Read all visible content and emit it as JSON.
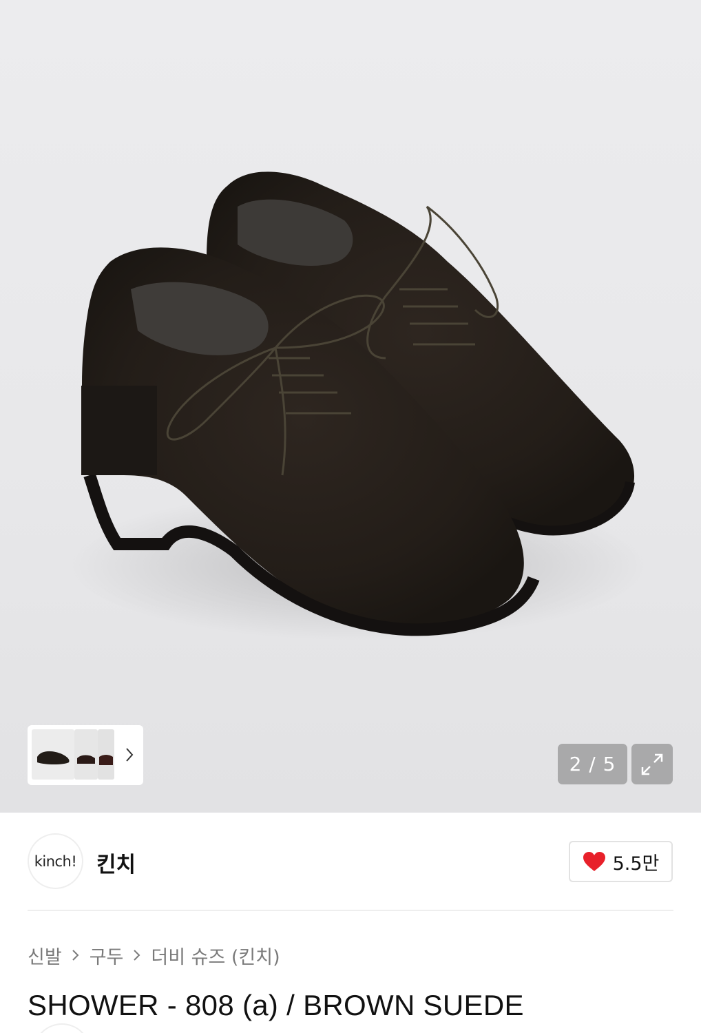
{
  "gallery": {
    "current": 2,
    "total": 5,
    "counter_text": "2 / 5",
    "thumbnails": [
      "shoe-pair-thumb",
      "shoe-side-thumb",
      "shoe-detail-thumb"
    ],
    "next_icon": "chevron-right-icon",
    "fullscreen_icon": "expand-arrows-icon",
    "background_color": "#e9e9eb"
  },
  "brand": {
    "logo_text": "kinch!",
    "name": "킨치",
    "likes": "5.5만",
    "like_icon": "heart-icon",
    "like_color": "#e8202a"
  },
  "breadcrumb": {
    "items": [
      "신발",
      "구두",
      "더비 슈즈 (킨치)"
    ],
    "separator_icon": "chevron-right-icon"
  },
  "product": {
    "title": "SHOWER - 808 (a) / BROWN SUEDE"
  }
}
